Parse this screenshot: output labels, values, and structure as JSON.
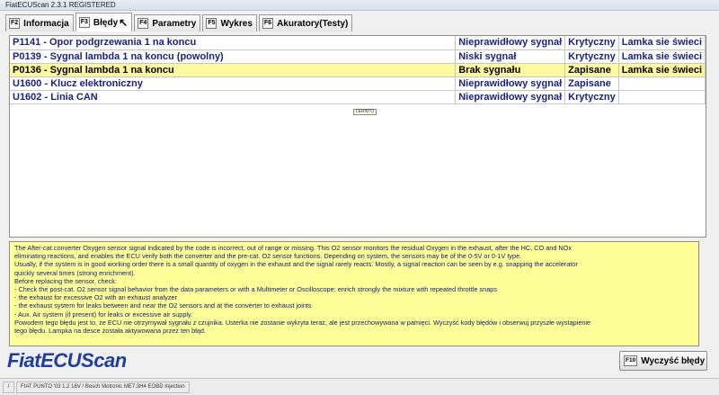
{
  "window": {
    "title": "FiatECUScan 2.3.1 REGISTERED"
  },
  "tabs": [
    {
      "key": "F2",
      "label": "Informacja"
    },
    {
      "key": "F3",
      "label": "Błędy"
    },
    {
      "key": "F4",
      "label": "Parametry"
    },
    {
      "key": "F5",
      "label": "Wykres"
    },
    {
      "key": "F6",
      "label": "Akuratory(Testy)"
    }
  ],
  "faults": [
    {
      "code": "P1141 - Opor podgrzewania 1 na koncu",
      "status": "Nieprawidłowy sygnał",
      "type": "Krytyczny",
      "lamp": "Lamka sie świeci"
    },
    {
      "code": "P0139 - Sygnal lambda 1 na koncu (powolny)",
      "status": "Niski sygnał",
      "type": "Krytyczny",
      "lamp": "Lamka sie świeci"
    },
    {
      "code": "P0136 - Sygnal lambda 1 na koncu",
      "status": "Brak sygnału",
      "type": "Zapisane",
      "lamp": "Lamka sie świeci"
    },
    {
      "code": "U1600 - Klucz elektroniczny",
      "status": "Nieprawidłowy sygnał",
      "type": "Zapisane",
      "lamp": ""
    },
    {
      "code": "U1602 - Linia CAN",
      "status": "Nieprawidłowy sygnał",
      "type": "Krytyczny",
      "lamp": ""
    }
  ],
  "center_tag": "LERNTO",
  "description": [
    "The After-cat.converter Oxygen sensor signal indicated by the code is incorrect, out of range or missing. This O2 sensor monitors the residual Oxygen in the exhaust, after the HC, CO and NOx",
    "eliminating reactions, and enables the ECU verify both the converter and the pre-cat. O2 sensor functions. Depending on system, the sensors may be of the 0-5V or 0-1V type.",
    "Usually, if the system is in good working order there is a small quantity of oxygen in the exhaust and the signal rarely reacts. Mostly, a signal reaction can be seen by e.g. snapping the accelerator",
    "quickly several times (strong enrichment).",
    "Before replacing the sensor, check:",
    "- Check the post-cat. O2 sensor signal behavior from the data parameters or with a Multimeter or Oscilloscope: enrich strongly the mixture with repeated throttle snaps",
    "- the exhaust for excessive O2 with an exhaust analyzer",
    "- the exhaust system for leaks between and near the O2 sensors and at the converter to exhaust joints",
    "- Aux. Air system (if present) for leaks or excessive air supply.",
    "Powodem tego błędu jest to, że ECU nie otrzymywał sygnału z czujnika. Usterka nie zostanie wykryta teraz, ale jest przechowywana w pamięci. Wyczyść kody błędów i obserwuj przyszłe wystąpienie",
    "tego błędu. Lampka na desce została aktywowana przez ten błąd."
  ],
  "logo": "FiatECUScan",
  "clear_button": {
    "key": "F10",
    "label": "Wyczyść błędy"
  },
  "statusbar": {
    "slash": "/",
    "vehicle": "FIAT PUNTO '03 1.2 16V / Bosch Motronic ME7.3H4 EOBD Injection"
  }
}
